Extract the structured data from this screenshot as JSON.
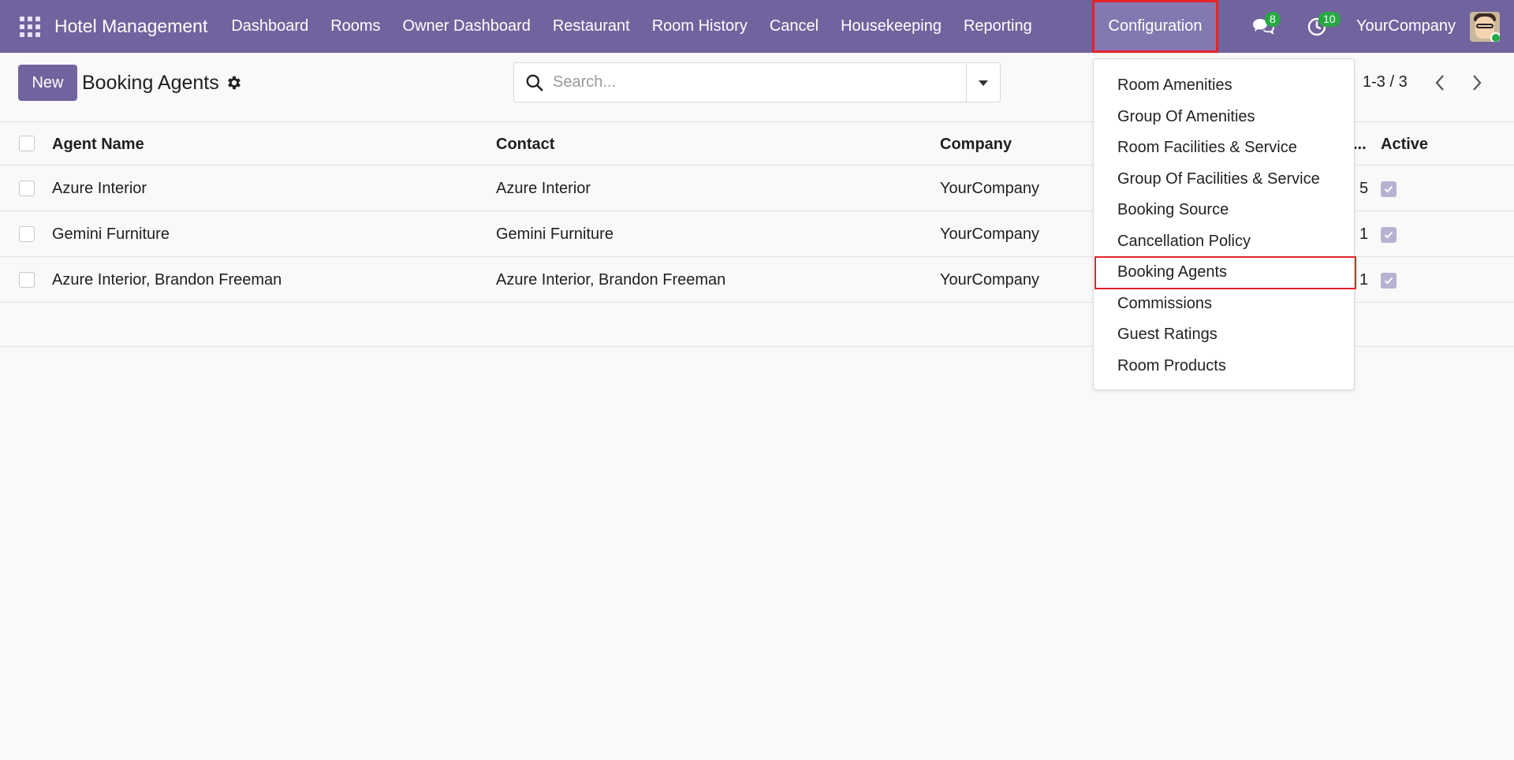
{
  "navbar": {
    "app_title": "Hotel Management",
    "menu": [
      "Dashboard",
      "Rooms",
      "Owner Dashboard",
      "Restaurant",
      "Room History",
      "Cancel",
      "Housekeeping",
      "Reporting"
    ],
    "active_menu": "Configuration",
    "messages_count": "8",
    "activities_count": "10",
    "company": "YourCompany"
  },
  "control": {
    "new_label": "New",
    "title": "Booking Agents",
    "search_placeholder": "Search...",
    "pager": "1-3 / 3"
  },
  "table": {
    "headers": {
      "agent_name": "Agent Name",
      "contact": "Contact",
      "company": "Company",
      "truncated": "...",
      "active": "Active"
    },
    "rows": [
      {
        "agent_name": "Azure Interior",
        "contact": "Azure Interior",
        "company": "YourCompany",
        "count": "5",
        "active": true
      },
      {
        "agent_name": "Gemini Furniture",
        "contact": "Gemini Furniture",
        "company": "YourCompany",
        "count": "1",
        "active": true
      },
      {
        "agent_name": "Azure Interior, Brandon Freeman",
        "contact": "Azure Interior, Brandon Freeman",
        "company": "YourCompany",
        "count": "1",
        "active": true
      }
    ]
  },
  "dropdown": {
    "items": [
      "Room Amenities",
      "Group Of Amenities",
      "Room Facilities & Service",
      "Group Of Facilities & Service",
      "Booking Source",
      "Cancellation Policy",
      "Booking Agents",
      "Commissions",
      "Guest Ratings",
      "Room Products"
    ],
    "selected": "Booking Agents"
  },
  "colors": {
    "navbar": "#71639e",
    "highlight_box": "#e3242b",
    "badge": "#28a745",
    "checkbox_checked": "#b8b1d1"
  }
}
